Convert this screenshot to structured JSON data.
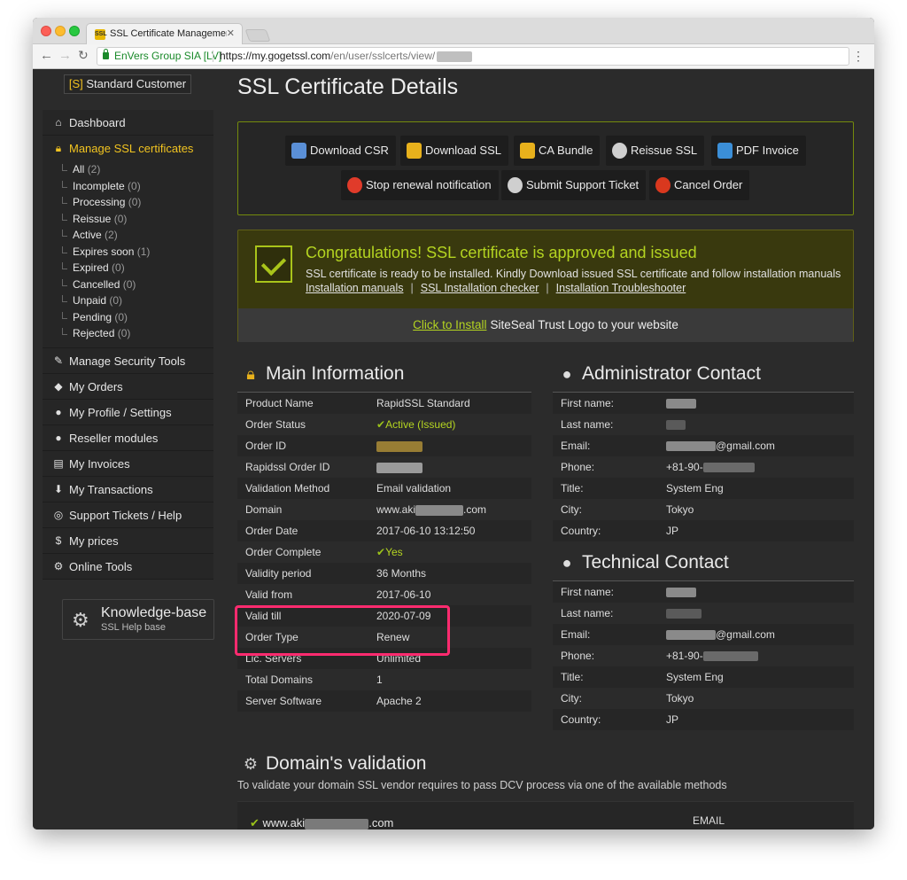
{
  "browser": {
    "tab_title": "SSL Certificate Management S",
    "tab_favicon": "SSL",
    "org_name": "EnVers Group SIA [LV]",
    "url_host": "https://my.gogetssl.com",
    "url_path": "/en/user/sslcerts/view/"
  },
  "sidebar": {
    "customer_badge_prefix": "[S]",
    "customer_badge_label": "Standard Customer",
    "items": [
      {
        "label": "Dashboard",
        "icon": "home-icon"
      },
      {
        "label": "Manage SSL certificates",
        "icon": "lock-icon"
      },
      {
        "label": "Manage Security Tools",
        "icon": "wrench-icon"
      },
      {
        "label": "My Orders",
        "icon": "tag-icon"
      },
      {
        "label": "My Profile / Settings",
        "icon": "user-icon"
      },
      {
        "label": "Reseller modules",
        "icon": "users-icon"
      },
      {
        "label": "My Invoices",
        "icon": "invoice-icon"
      },
      {
        "label": "My Transactions",
        "icon": "download-icon"
      },
      {
        "label": "Support Tickets / Help",
        "icon": "lifebuoy-icon"
      },
      {
        "label": "My prices",
        "icon": "dollar-icon"
      },
      {
        "label": "Online Tools",
        "icon": "gear-icon"
      }
    ],
    "ssl_subitems": [
      {
        "label": "All",
        "count": "(2)"
      },
      {
        "label": "Incomplete",
        "count": "(0)"
      },
      {
        "label": "Processing",
        "count": "(0)"
      },
      {
        "label": "Reissue",
        "count": "(0)"
      },
      {
        "label": "Active",
        "count": "(2)"
      },
      {
        "label": "Expires soon",
        "count": "(1)"
      },
      {
        "label": "Expired",
        "count": "(0)"
      },
      {
        "label": "Cancelled",
        "count": "(0)"
      },
      {
        "label": "Unpaid",
        "count": "(0)"
      },
      {
        "label": "Pending",
        "count": "(0)"
      },
      {
        "label": "Rejected",
        "count": "(0)"
      }
    ],
    "kb_title": "Knowledge-base",
    "kb_subtitle": "SSL Help base"
  },
  "main": {
    "title": "SSL Certificate Details",
    "actions": [
      {
        "label": "Download CSR",
        "icon": "floppy-icon",
        "color": "#5a8fd6"
      },
      {
        "label": "Download SSL",
        "icon": "padlock-icon",
        "color": "#e8b11c"
      },
      {
        "label": "CA Bundle",
        "icon": "padlock-icon",
        "color": "#e8b11c"
      },
      {
        "label": "Reissue SSL",
        "icon": "gear-warning-icon",
        "color": "#cfcfcf"
      },
      {
        "label": "PDF Invoice",
        "icon": "document-icon",
        "color": "#3b8fd8"
      },
      {
        "label": "Stop renewal notification",
        "icon": "minus-circle-icon",
        "color": "#e03b2a"
      },
      {
        "label": "Submit Support Ticket",
        "icon": "gear-info-icon",
        "color": "#cfcfcf"
      },
      {
        "label": "Cancel Order",
        "icon": "x-circle-icon",
        "color": "#d9381e"
      }
    ],
    "congrats": {
      "title": "Congratulations! SSL certificate is approved and issued",
      "text": "SSL certificate is ready to be installed. Kindly Download issued SSL certificate and follow installation manuals",
      "links": [
        "Installation manuals",
        "SSL Installation checker",
        "Installation Troubleshooter"
      ],
      "siteseal_link": "Click to Install",
      "siteseal_text": "SiteSeal Trust Logo to your website"
    },
    "main_info": {
      "title": "Main Information",
      "rows": [
        {
          "key": "Product Name",
          "value": "RapidSSL Standard"
        },
        {
          "key": "Order Status",
          "value": "Active (Issued)",
          "green": true
        },
        {
          "key": "Order ID",
          "value": ""
        },
        {
          "key": "Rapidssl Order ID",
          "value": ""
        },
        {
          "key": "Validation Method",
          "value": "Email validation"
        },
        {
          "key": "Domain",
          "value": "www.aki",
          "value2": ".com"
        },
        {
          "key": "Order Date",
          "value": "2017-06-10 13:12:50"
        },
        {
          "key": "Order Complete",
          "value": "Yes",
          "green": true
        },
        {
          "key": "Validity period",
          "value": "36 Months"
        },
        {
          "key": "Valid from",
          "value": "2017-06-10"
        },
        {
          "key": "Valid till",
          "value": "2020-07-09"
        },
        {
          "key": "Order Type",
          "value": "Renew"
        },
        {
          "key": "Lic. Servers",
          "value": "Unlimited"
        },
        {
          "key": "Total Domains",
          "value": "1"
        },
        {
          "key": "Server Software",
          "value": "Apache 2"
        }
      ]
    },
    "admin_contact": {
      "title": "Administrator Contact",
      "rows": [
        {
          "key": "First name:",
          "value": ""
        },
        {
          "key": "Last name:",
          "value": ""
        },
        {
          "key": "Email:",
          "value": "@gmail.com"
        },
        {
          "key": "Phone:",
          "value": "+81-90-"
        },
        {
          "key": "Title:",
          "value": "System Eng"
        },
        {
          "key": "City:",
          "value": "Tokyo"
        },
        {
          "key": "Country:",
          "value": "JP"
        }
      ]
    },
    "tech_contact": {
      "title": "Technical Contact",
      "rows": [
        {
          "key": "First name:",
          "value": ""
        },
        {
          "key": "Last name:",
          "value": ""
        },
        {
          "key": "Email:",
          "value": "@gmail.com"
        },
        {
          "key": "Phone:",
          "value": "+81-90-"
        },
        {
          "key": "Title:",
          "value": "System Eng"
        },
        {
          "key": "City:",
          "value": "Tokyo"
        },
        {
          "key": "Country:",
          "value": "JP"
        }
      ]
    },
    "domain_validation": {
      "title": "Domain's validation",
      "subtitle": "To validate your domain SSL vendor requires to pass DCV process via one of the available methods",
      "domain": "www.aki",
      "domain_tail": ".com",
      "method": "EMAIL"
    }
  },
  "colors": {
    "accent_green": "#b4d421",
    "accent_yellow": "#f2c420",
    "highlight": "#ff2b6f"
  }
}
